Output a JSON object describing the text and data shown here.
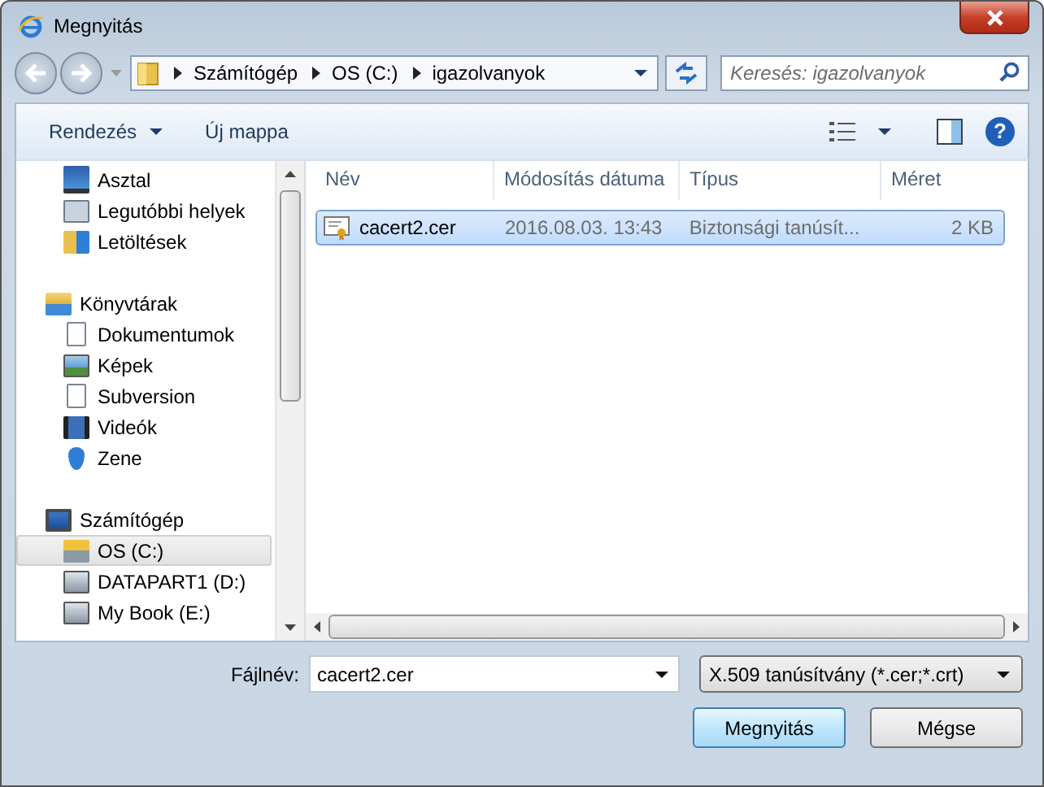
{
  "window": {
    "title": "Megnyitás"
  },
  "address_bar": {
    "path": [
      "Számítógép",
      "OS (C:)",
      "igazolvanyok"
    ]
  },
  "search": {
    "placeholder": "Keresés: igazolvanyok"
  },
  "toolbar": {
    "buttons": [
      {
        "label": "Rendezés",
        "dropdown": true
      },
      {
        "label": "Új mappa",
        "dropdown": false
      }
    ],
    "help": "?"
  },
  "nav_pane": {
    "favorites": [
      {
        "label": "Asztal",
        "kind": "desktop",
        "selected": false
      },
      {
        "label": "Legutóbbi helyek",
        "kind": "recent",
        "selected": false
      },
      {
        "label": "Letöltések",
        "kind": "downloads",
        "selected": false
      }
    ],
    "groups": [
      {
        "label": "Könyvtárak",
        "kind": "library",
        "children": [
          {
            "label": "Dokumentumok",
            "kind": "documents",
            "selected": false
          },
          {
            "label": "Képek",
            "kind": "pictures",
            "selected": false
          },
          {
            "label": "Subversion",
            "kind": "documents",
            "selected": false
          },
          {
            "label": "Videók",
            "kind": "videos",
            "selected": false
          },
          {
            "label": "Zene",
            "kind": "music",
            "selected": false
          }
        ]
      },
      {
        "label": "Számítógép",
        "kind": "computer",
        "children": [
          {
            "label": "OS (C:)",
            "kind": "system-drive",
            "selected": true
          },
          {
            "label": "DATAPART1 (D:)",
            "kind": "drive",
            "selected": false
          },
          {
            "label": "My Book (E:)",
            "kind": "drive",
            "selected": false
          }
        ]
      }
    ]
  },
  "file_list": {
    "columns": [
      "Név",
      "Módosítás dátuma",
      "Típus",
      "Méret"
    ],
    "rows": [
      {
        "name": "cacert2.cer",
        "modified": "2016.08.03. 13:43",
        "type": "Biztonsági tanúsít...",
        "size": "2 KB",
        "selected": true
      }
    ]
  },
  "footer": {
    "filename_label": "Fájlnév:",
    "filename": "cacert2.cer",
    "file_type": "X.509 tanúsítvány (*.cer;*.crt)",
    "buttons": [
      {
        "label": "Megnyitás",
        "primary": true
      },
      {
        "label": "Mégse",
        "primary": false
      }
    ]
  }
}
